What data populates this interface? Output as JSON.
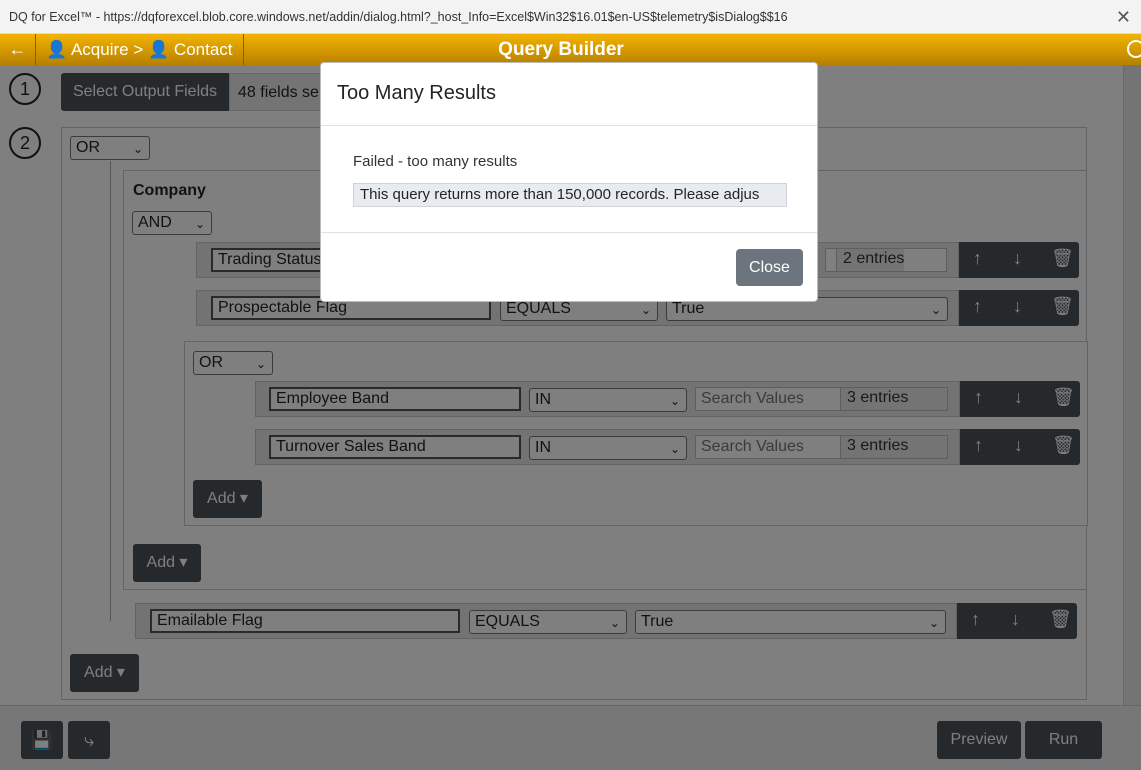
{
  "window": {
    "title": "DQ for Excel™ - https://dqforexcel.blob.core.windows.net/addin/dialog.html?_host_Info=Excel$Win32$16.01$en-US$telemetry$isDialog$$16"
  },
  "appbar": {
    "breadcrumb_acquire": "Acquire",
    "breadcrumb_sep": ">",
    "breadcrumb_contact": "Contact",
    "title": "Query Builder"
  },
  "steps": {
    "step1": "1",
    "step2": "2"
  },
  "output": {
    "select_button": "Select Output Fields",
    "fields_selected": "48 fields se"
  },
  "root": {
    "operator": "OR",
    "company_label": "Company",
    "company_operator": "AND",
    "rows": [
      {
        "field": "Trading Status",
        "entries": "2 entries"
      },
      {
        "field": "Prospectable Flag",
        "operator": "EQUALS",
        "value": "True"
      }
    ],
    "nested_operator": "OR",
    "nested_rows": [
      {
        "field": "Employee Band",
        "operator": "IN",
        "placeholder": "Search Values",
        "entries": "3 entries"
      },
      {
        "field": "Turnover Sales Band",
        "operator": "IN",
        "placeholder": "Search Values",
        "entries": "3 entries"
      }
    ],
    "add_label": "Add",
    "email_row": {
      "field": "Emailable Flag",
      "operator": "EQUALS",
      "value": "True"
    }
  },
  "footer": {
    "preview": "Preview",
    "run": "Run"
  },
  "modal": {
    "title": "Too Many Results",
    "message": "Failed - too many results",
    "detail": "This query returns more than 150,000 records. Please adjus",
    "close": "Close"
  }
}
